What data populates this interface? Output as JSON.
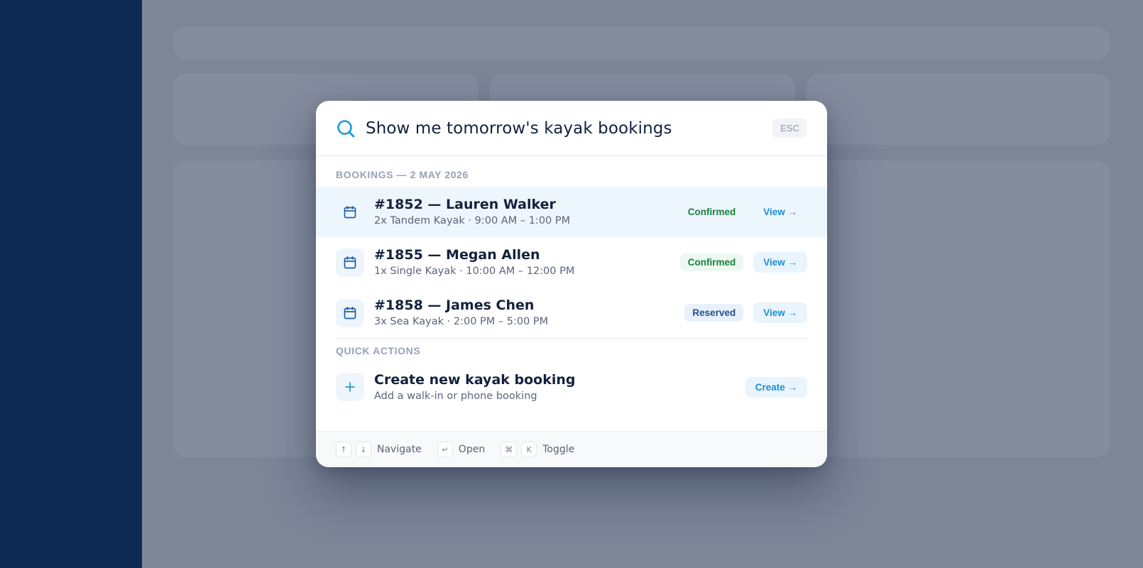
{
  "search": {
    "query": "Show me tomorrow's kayak bookings",
    "esc_label": "ESC"
  },
  "bookings_section": {
    "label": "BOOKINGS — 2 MAY 2026",
    "items": [
      {
        "title": "#1852 — Lauren Walker",
        "subtitle": "2x Tandem Kayak · 9:00 AM – 1:00 PM",
        "status": "Confirmed",
        "action": "View →",
        "icon": "calendar-icon"
      },
      {
        "title": "#1855 — Megan Allen",
        "subtitle": "1x Single Kayak · 10:00 AM – 12:00 PM",
        "status": "Confirmed",
        "action": "View →",
        "icon": "calendar-icon"
      },
      {
        "title": "#1858 — James Chen",
        "subtitle": "3x Sea Kayak · 2:00 PM – 5:00 PM",
        "status": "Reserved",
        "action": "View →",
        "icon": "calendar-icon"
      }
    ]
  },
  "quick_actions": {
    "label": "QUICK ACTIONS",
    "items": [
      {
        "title": "Create new kayak booking",
        "subtitle": "Add a walk-in or phone booking",
        "action": "Create →",
        "icon": "plus-icon"
      }
    ]
  },
  "footer": {
    "up_key": "↑",
    "down_key": "↓",
    "navigate_label": "Navigate",
    "enter_key": "↵",
    "open_label": "Open",
    "cmd_key": "⌘",
    "k_key": "K",
    "toggle_label": "Toggle"
  },
  "colors": {
    "sidebar": "#0f2a52",
    "overlay": "#7d8597",
    "accent": "#1a8fd6",
    "confirmed": "#16803c",
    "reserved": "#1f4f8f"
  }
}
